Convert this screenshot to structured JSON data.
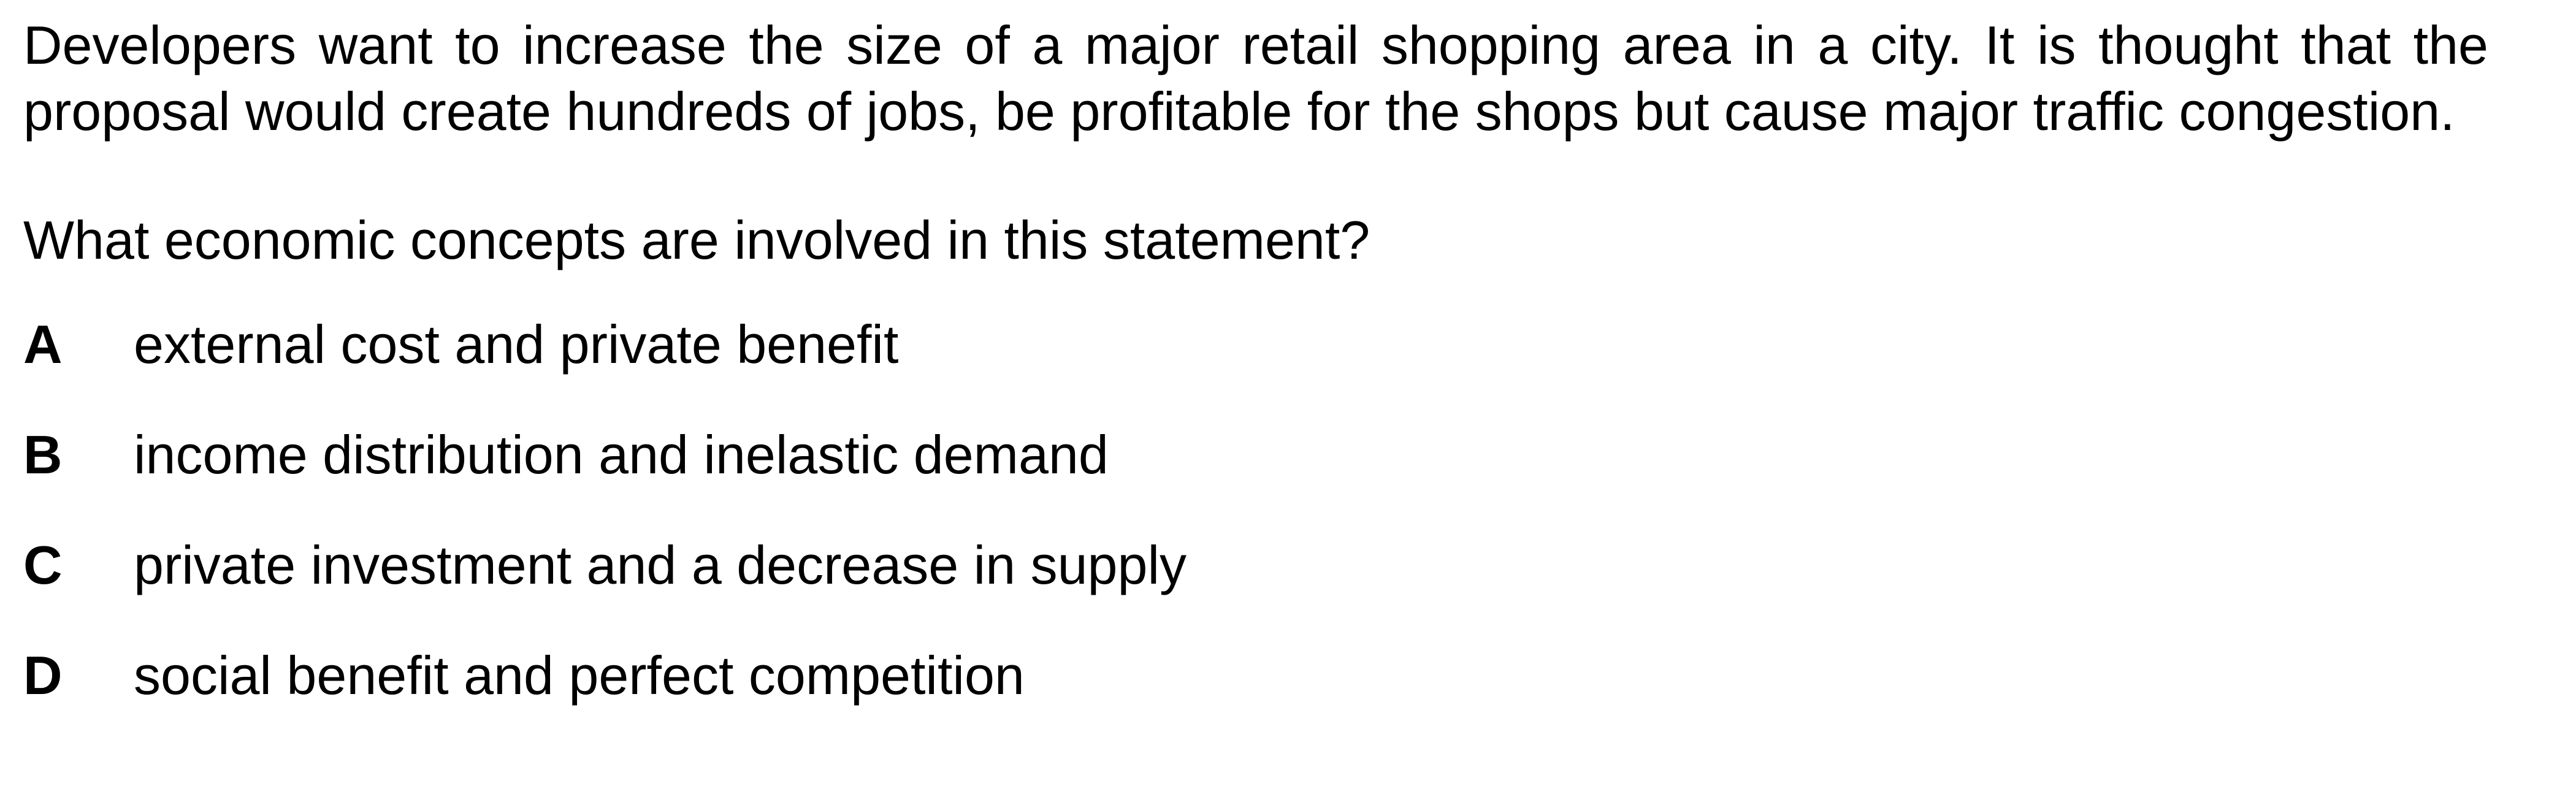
{
  "question": {
    "stem": "Developers want to increase the size of a major retail shopping area in a city. It is thought that the proposal would create hundreds of jobs, be profitable for the shops but cause major traffic congestion.",
    "prompt": "What economic concepts are involved in this statement?"
  },
  "options": [
    {
      "letter": "A",
      "text": "external cost and private benefit"
    },
    {
      "letter": "B",
      "text": "income distribution and inelastic demand"
    },
    {
      "letter": "C",
      "text": "private investment and a decrease in supply"
    },
    {
      "letter": "D",
      "text": "social benefit and perfect competition"
    }
  ]
}
